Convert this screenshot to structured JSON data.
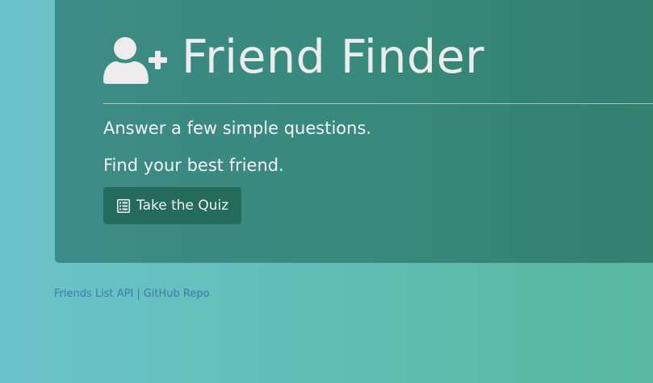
{
  "jumbotron": {
    "title": "Friend Finder",
    "line1": "Answer a few simple questions.",
    "line2": "Find your best friend.",
    "button_label": "Take the Quiz"
  },
  "footer": {
    "api_link": "Friends List API",
    "separator": "|",
    "repo_link": "GitHub Repo"
  },
  "icons": {
    "title_icon": "user-plus-icon",
    "button_icon": "list-alt-icon"
  },
  "colors": {
    "background_left": "#6bc3ca",
    "background_right": "#58b79c",
    "jumbotron": "#378a7c",
    "button": "#256b5c",
    "link": "#3a7bb0"
  }
}
